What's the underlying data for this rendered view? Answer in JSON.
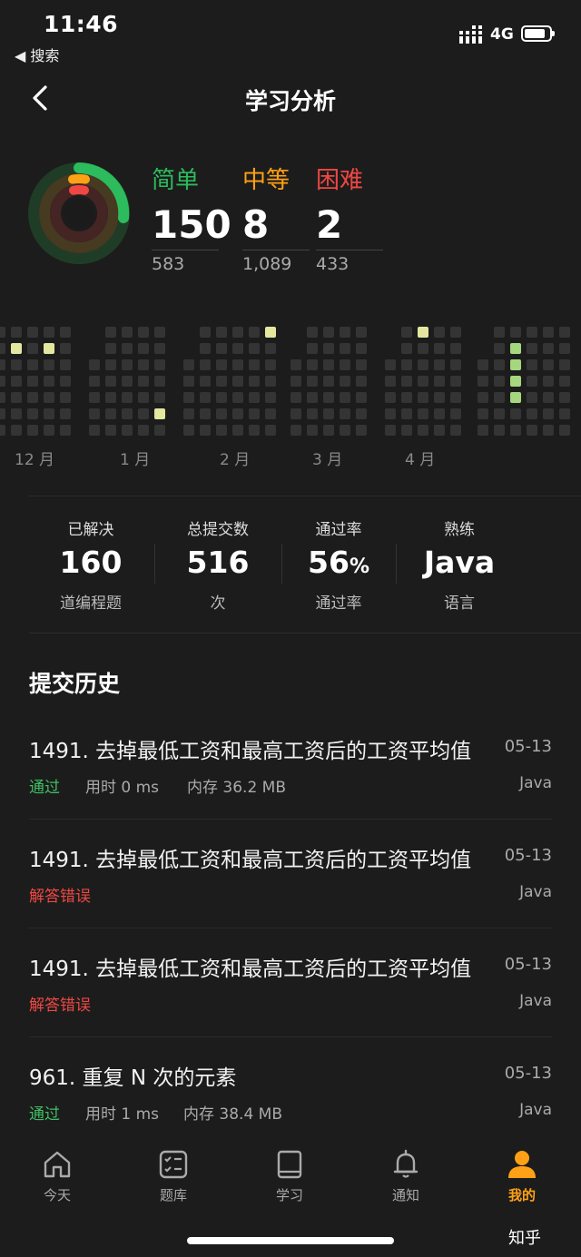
{
  "status_bar": {
    "time": "11:46",
    "back_app": "◀ 搜索",
    "network": "4G"
  },
  "header": {
    "title": "学习分析"
  },
  "colors": {
    "easy": "#2cbb5d",
    "medium": "#ffa116",
    "hard": "#ef4743",
    "pass": "#3fbf62",
    "fail": "#ef4743",
    "accent": "#ffa116"
  },
  "difficulty": {
    "easy": {
      "label": "简单",
      "solved": "150",
      "total": "583"
    },
    "medium": {
      "label": "中等",
      "solved": "8",
      "total": "1,089"
    },
    "hard": {
      "label": "困难",
      "solved": "2",
      "total": "433"
    }
  },
  "heatmap": {
    "months": [
      "12 月",
      "1 月",
      "2 月",
      "3 月",
      "4 月"
    ]
  },
  "stats": [
    {
      "title": "已解决",
      "value": "160",
      "unit": "",
      "sub": "道编程题"
    },
    {
      "title": "总提交数",
      "value": "516",
      "unit": "",
      "sub": "次"
    },
    {
      "title": "通过率",
      "value": "56",
      "unit": "%",
      "sub": "通过率"
    },
    {
      "title": "熟练",
      "value": "Java",
      "unit": "",
      "sub": "语言"
    }
  ],
  "history": {
    "title": "提交历史",
    "items": [
      {
        "title": "1491. 去掉最低工资和最高工资后的工资平均值",
        "date": "05-13",
        "status": "通过",
        "time": "用时 0 ms",
        "memory": "内存 36.2 MB",
        "lang": "Java"
      },
      {
        "title": "1491. 去掉最低工资和最高工资后的工资平均值",
        "date": "05-13",
        "status": "解答错误",
        "time": "",
        "memory": "",
        "lang": "Java"
      },
      {
        "title": "1491. 去掉最低工资和最高工资后的工资平均值",
        "date": "05-13",
        "status": "解答错误",
        "time": "",
        "memory": "",
        "lang": "Java"
      },
      {
        "title": "961. 重复 N 次的元素",
        "date": "05-13",
        "status": "通过",
        "time": "用时 1 ms",
        "memory": "内存 38.4 MB",
        "lang": "Java"
      }
    ]
  },
  "tabs": [
    {
      "label": "今天",
      "icon": "home-icon"
    },
    {
      "label": "题库",
      "icon": "checklist-icon"
    },
    {
      "label": "学习",
      "icon": "book-icon"
    },
    {
      "label": "通知",
      "icon": "bell-icon"
    },
    {
      "label": "我的",
      "icon": "user-icon",
      "active": true
    }
  ],
  "watermark": "知乎"
}
